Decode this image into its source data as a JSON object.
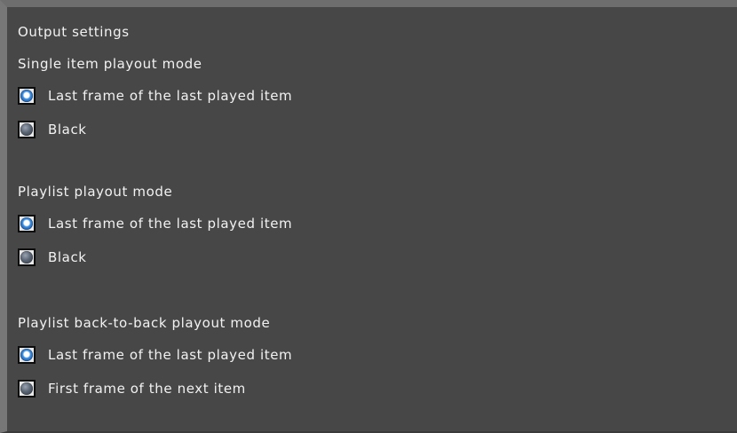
{
  "panel": {
    "title": "Output settings"
  },
  "groups": [
    {
      "label": "Single item playout mode",
      "options": [
        {
          "label": "Last frame of the last played item",
          "selected": true
        },
        {
          "label": "Black",
          "selected": false
        }
      ]
    },
    {
      "label": "Playlist playout mode",
      "options": [
        {
          "label": "Last frame of the last played item",
          "selected": true
        },
        {
          "label": "Black",
          "selected": false
        }
      ]
    },
    {
      "label": "Playlist back-to-back playout mode",
      "options": [
        {
          "label": "Last frame of the last played item",
          "selected": true
        },
        {
          "label": "First frame of the next item",
          "selected": false
        }
      ]
    }
  ],
  "colors": {
    "background": "#474747",
    "text": "#f2f2f2",
    "radio_selected": "#1b5fb0",
    "radio_unselected": "#5b6675"
  }
}
